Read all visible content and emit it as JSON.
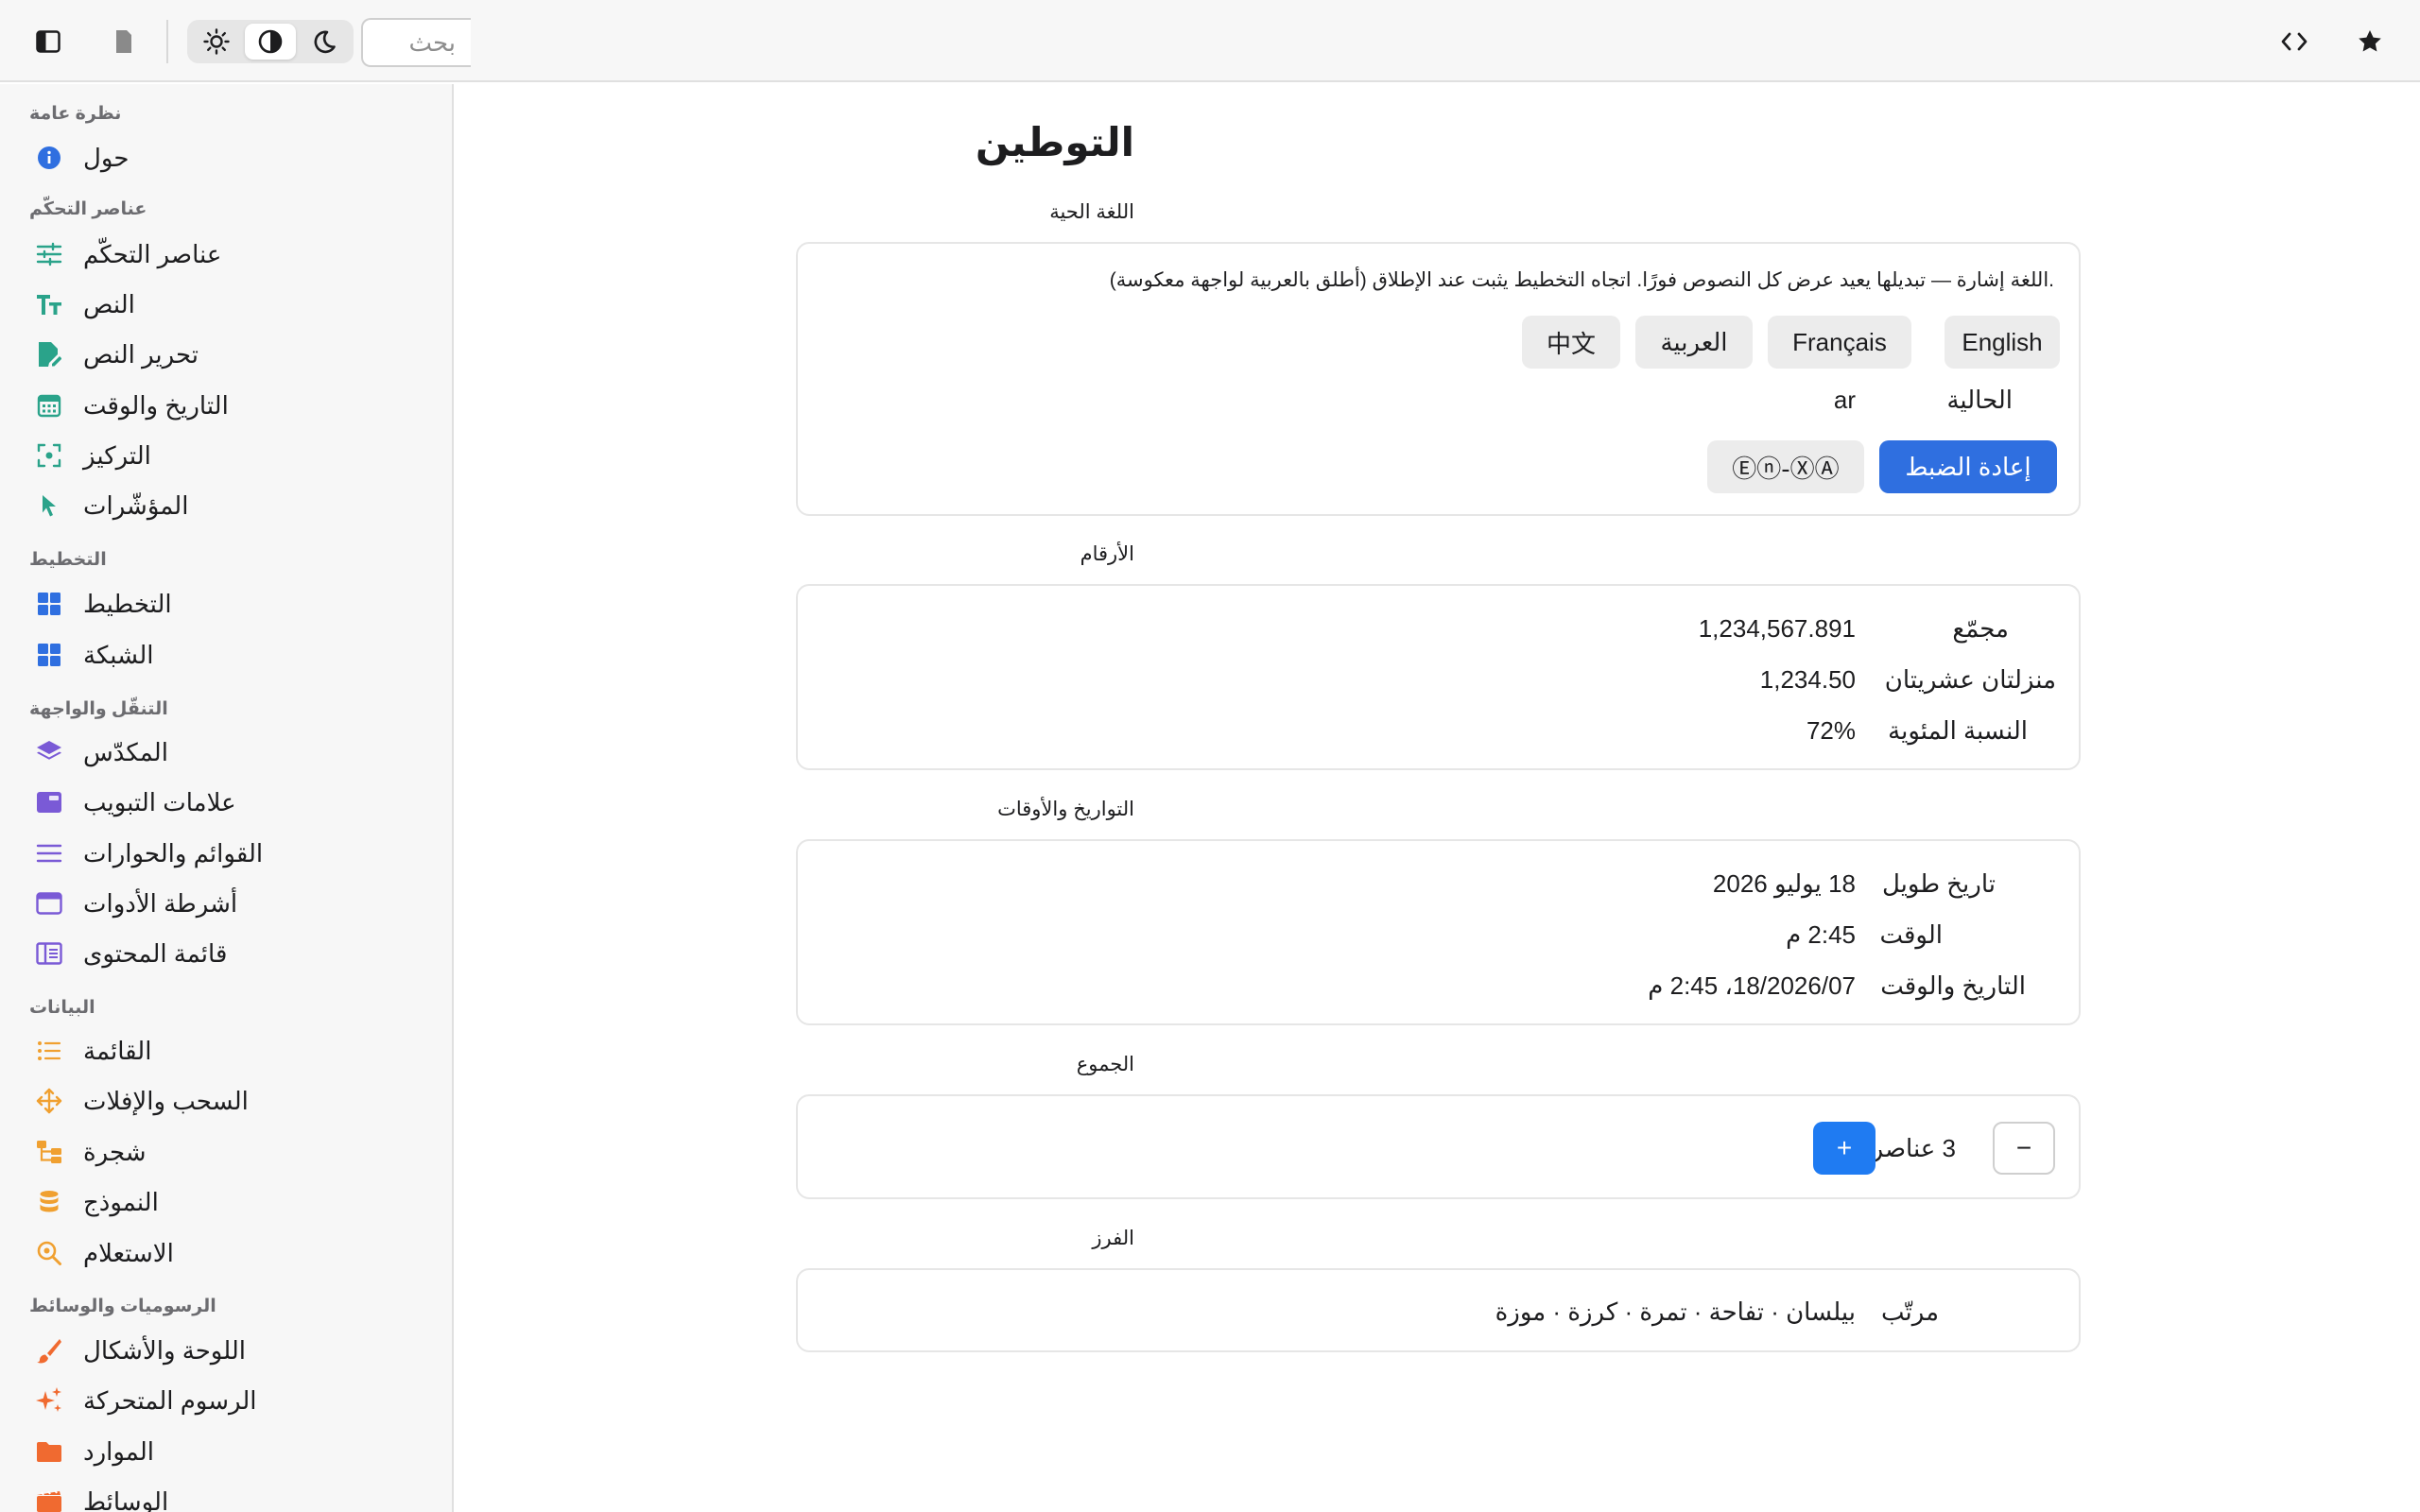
{
  "toolbar": {
    "search_placeholder": "بحث",
    "icons": [
      "sidebar-toggle-icon",
      "document-icon",
      "sun-icon",
      "contrast-icon",
      "moon-icon",
      "code-icon",
      "star-icon"
    ]
  },
  "sidebar": {
    "sections": [
      {
        "title": "نظرة عامة",
        "items": [
          {
            "label": "حول",
            "icon": "info-icon",
            "color": "#2f6fe0"
          }
        ]
      },
      {
        "title": "عناصر التحكّم",
        "items": [
          {
            "label": "عناصر التحكّم",
            "icon": "sliders-icon",
            "color": "#2aa38a"
          },
          {
            "label": "النص",
            "icon": "text-size-icon",
            "color": "#2aa38a"
          },
          {
            "label": "تحرير النص",
            "icon": "edit-document-icon",
            "color": "#2aa38a"
          },
          {
            "label": "التاريخ والوقت",
            "icon": "calendar-icon",
            "color": "#2aa38a"
          },
          {
            "label": "التركيز",
            "icon": "focus-icon",
            "color": "#2aa38a"
          },
          {
            "label": "المؤشّرات",
            "icon": "pointer-icon",
            "color": "#2aa38a"
          }
        ]
      },
      {
        "title": "التخطيط",
        "items": [
          {
            "label": "التخطيط",
            "icon": "layout-grid-icon",
            "color": "#2f6fe0"
          },
          {
            "label": "الشبكة",
            "icon": "grid-icon",
            "color": "#2f6fe0"
          }
        ]
      },
      {
        "title": "التنقّل والواجهة",
        "items": [
          {
            "label": "المكدّس",
            "icon": "stack-icon",
            "color": "#7a5ad6"
          },
          {
            "label": "علامات التبويب",
            "icon": "tabs-icon",
            "color": "#7a5ad6"
          },
          {
            "label": "القوائم والحوارات",
            "icon": "menu-icon",
            "color": "#7a5ad6"
          },
          {
            "label": "أشرطة الأدوات",
            "icon": "toolbar-window-icon",
            "color": "#7a5ad6"
          },
          {
            "label": "قائمة المحتوى",
            "icon": "content-list-icon",
            "color": "#7a5ad6"
          }
        ]
      },
      {
        "title": "البيانات",
        "items": [
          {
            "label": "القائمة",
            "icon": "list-icon",
            "color": "#f0a030"
          },
          {
            "label": "السحب والإفلات",
            "icon": "move-icon",
            "color": "#f0a030"
          },
          {
            "label": "شجرة",
            "icon": "tree-icon",
            "color": "#f0a030"
          },
          {
            "label": "النموذج",
            "icon": "database-icon",
            "color": "#f0a030"
          },
          {
            "label": "الاستعلام",
            "icon": "query-icon",
            "color": "#f0a030"
          }
        ]
      },
      {
        "title": "الرسوميات والوسائط",
        "items": [
          {
            "label": "اللوحة والأشكال",
            "icon": "brush-icon",
            "color": "#f06a30"
          },
          {
            "label": "الرسوم المتحركة",
            "icon": "sparkles-icon",
            "color": "#f06a30"
          },
          {
            "label": "الموارد",
            "icon": "folder-icon",
            "color": "#f06a30"
          },
          {
            "label": "الوسائط",
            "icon": "film-icon",
            "color": "#f06a30"
          }
        ]
      }
    ]
  },
  "main": {
    "title": "التوطين",
    "live_language": {
      "label": "اللغة الحية",
      "description": ".اللغة إشارة — تبديلها يعيد عرض كل النصوص فورًا. اتجاه التخطيط يثبت عند الإطلاق (أطلق بالعربية لواجهة معكوسة)",
      "languages": [
        "English",
        "Français",
        "العربية",
        "中文"
      ],
      "current_label": "الحالية",
      "current_value": "ar",
      "reset_label": "إعادة الضبط",
      "pseudo_label": "Ⓔⓝ-ⓍⒶ"
    },
    "numbers": {
      "label": "الأرقام",
      "rows": [
        {
          "key": "مجمّع",
          "value": "1,234,567.891"
        },
        {
          "key": "منزلتان عشريتان",
          "value": "1,234.50"
        },
        {
          "key": "النسبة المئوية",
          "value": "72%"
        }
      ]
    },
    "dates": {
      "label": "التواريخ والأوقات",
      "rows": [
        {
          "key": "تاريخ طويل",
          "value": "18 يوليو 2026"
        },
        {
          "key": "الوقت",
          "value": "2:45 م"
        },
        {
          "key": "التاريخ والوقت",
          "value": "18/2026/07، 2:45 م"
        }
      ]
    },
    "plurals": {
      "label": "الجموع",
      "count_text": "3 عناصر",
      "minus": "−",
      "plus": "+"
    },
    "sorting": {
      "label": "الفرز",
      "key": "مرتّب",
      "value": "بيلسان · تفاحة · تمرة · كرزة · موزة"
    }
  },
  "colors": {
    "accent": "#2f6fe0",
    "plus_button": "#1f7bf2",
    "sidebar_bg": "#f7f7f7"
  }
}
